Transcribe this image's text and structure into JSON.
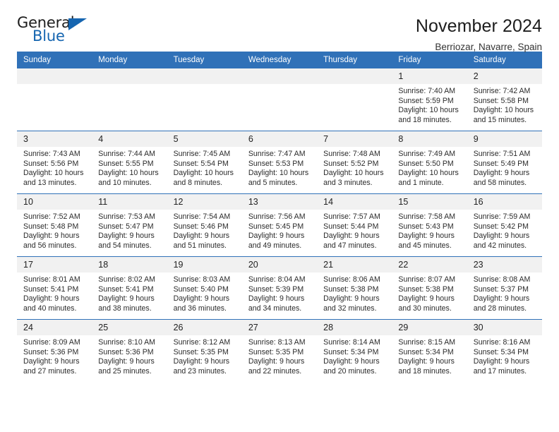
{
  "brand": {
    "word_one": "General",
    "word_two": "Blue",
    "accent_color": "#1565b0",
    "triangle_icon": "triangle-right-icon"
  },
  "header": {
    "title": "November 2024",
    "subtitle": "Berriozar, Navarre, Spain"
  },
  "calendar": {
    "header_bg": "#3071b8",
    "daynum_bg": "#f1f1f1",
    "weekdays": [
      "Sunday",
      "Monday",
      "Tuesday",
      "Wednesday",
      "Thursday",
      "Friday",
      "Saturday"
    ],
    "weeks": [
      [
        {
          "day": "",
          "empty": true
        },
        {
          "day": "",
          "empty": true
        },
        {
          "day": "",
          "empty": true
        },
        {
          "day": "",
          "empty": true
        },
        {
          "day": "",
          "empty": true
        },
        {
          "day": "1",
          "sunrise": "Sunrise: 7:40 AM",
          "sunset": "Sunset: 5:59 PM",
          "daylight_1": "Daylight: 10 hours",
          "daylight_2": "and 18 minutes."
        },
        {
          "day": "2",
          "sunrise": "Sunrise: 7:42 AM",
          "sunset": "Sunset: 5:58 PM",
          "daylight_1": "Daylight: 10 hours",
          "daylight_2": "and 15 minutes."
        }
      ],
      [
        {
          "day": "3",
          "sunrise": "Sunrise: 7:43 AM",
          "sunset": "Sunset: 5:56 PM",
          "daylight_1": "Daylight: 10 hours",
          "daylight_2": "and 13 minutes."
        },
        {
          "day": "4",
          "sunrise": "Sunrise: 7:44 AM",
          "sunset": "Sunset: 5:55 PM",
          "daylight_1": "Daylight: 10 hours",
          "daylight_2": "and 10 minutes."
        },
        {
          "day": "5",
          "sunrise": "Sunrise: 7:45 AM",
          "sunset": "Sunset: 5:54 PM",
          "daylight_1": "Daylight: 10 hours",
          "daylight_2": "and 8 minutes."
        },
        {
          "day": "6",
          "sunrise": "Sunrise: 7:47 AM",
          "sunset": "Sunset: 5:53 PM",
          "daylight_1": "Daylight: 10 hours",
          "daylight_2": "and 5 minutes."
        },
        {
          "day": "7",
          "sunrise": "Sunrise: 7:48 AM",
          "sunset": "Sunset: 5:52 PM",
          "daylight_1": "Daylight: 10 hours",
          "daylight_2": "and 3 minutes."
        },
        {
          "day": "8",
          "sunrise": "Sunrise: 7:49 AM",
          "sunset": "Sunset: 5:50 PM",
          "daylight_1": "Daylight: 10 hours",
          "daylight_2": "and 1 minute."
        },
        {
          "day": "9",
          "sunrise": "Sunrise: 7:51 AM",
          "sunset": "Sunset: 5:49 PM",
          "daylight_1": "Daylight: 9 hours",
          "daylight_2": "and 58 minutes."
        }
      ],
      [
        {
          "day": "10",
          "sunrise": "Sunrise: 7:52 AM",
          "sunset": "Sunset: 5:48 PM",
          "daylight_1": "Daylight: 9 hours",
          "daylight_2": "and 56 minutes."
        },
        {
          "day": "11",
          "sunrise": "Sunrise: 7:53 AM",
          "sunset": "Sunset: 5:47 PM",
          "daylight_1": "Daylight: 9 hours",
          "daylight_2": "and 54 minutes."
        },
        {
          "day": "12",
          "sunrise": "Sunrise: 7:54 AM",
          "sunset": "Sunset: 5:46 PM",
          "daylight_1": "Daylight: 9 hours",
          "daylight_2": "and 51 minutes."
        },
        {
          "day": "13",
          "sunrise": "Sunrise: 7:56 AM",
          "sunset": "Sunset: 5:45 PM",
          "daylight_1": "Daylight: 9 hours",
          "daylight_2": "and 49 minutes."
        },
        {
          "day": "14",
          "sunrise": "Sunrise: 7:57 AM",
          "sunset": "Sunset: 5:44 PM",
          "daylight_1": "Daylight: 9 hours",
          "daylight_2": "and 47 minutes."
        },
        {
          "day": "15",
          "sunrise": "Sunrise: 7:58 AM",
          "sunset": "Sunset: 5:43 PM",
          "daylight_1": "Daylight: 9 hours",
          "daylight_2": "and 45 minutes."
        },
        {
          "day": "16",
          "sunrise": "Sunrise: 7:59 AM",
          "sunset": "Sunset: 5:42 PM",
          "daylight_1": "Daylight: 9 hours",
          "daylight_2": "and 42 minutes."
        }
      ],
      [
        {
          "day": "17",
          "sunrise": "Sunrise: 8:01 AM",
          "sunset": "Sunset: 5:41 PM",
          "daylight_1": "Daylight: 9 hours",
          "daylight_2": "and 40 minutes."
        },
        {
          "day": "18",
          "sunrise": "Sunrise: 8:02 AM",
          "sunset": "Sunset: 5:41 PM",
          "daylight_1": "Daylight: 9 hours",
          "daylight_2": "and 38 minutes."
        },
        {
          "day": "19",
          "sunrise": "Sunrise: 8:03 AM",
          "sunset": "Sunset: 5:40 PM",
          "daylight_1": "Daylight: 9 hours",
          "daylight_2": "and 36 minutes."
        },
        {
          "day": "20",
          "sunrise": "Sunrise: 8:04 AM",
          "sunset": "Sunset: 5:39 PM",
          "daylight_1": "Daylight: 9 hours",
          "daylight_2": "and 34 minutes."
        },
        {
          "day": "21",
          "sunrise": "Sunrise: 8:06 AM",
          "sunset": "Sunset: 5:38 PM",
          "daylight_1": "Daylight: 9 hours",
          "daylight_2": "and 32 minutes."
        },
        {
          "day": "22",
          "sunrise": "Sunrise: 8:07 AM",
          "sunset": "Sunset: 5:38 PM",
          "daylight_1": "Daylight: 9 hours",
          "daylight_2": "and 30 minutes."
        },
        {
          "day": "23",
          "sunrise": "Sunrise: 8:08 AM",
          "sunset": "Sunset: 5:37 PM",
          "daylight_1": "Daylight: 9 hours",
          "daylight_2": "and 28 minutes."
        }
      ],
      [
        {
          "day": "24",
          "sunrise": "Sunrise: 8:09 AM",
          "sunset": "Sunset: 5:36 PM",
          "daylight_1": "Daylight: 9 hours",
          "daylight_2": "and 27 minutes."
        },
        {
          "day": "25",
          "sunrise": "Sunrise: 8:10 AM",
          "sunset": "Sunset: 5:36 PM",
          "daylight_1": "Daylight: 9 hours",
          "daylight_2": "and 25 minutes."
        },
        {
          "day": "26",
          "sunrise": "Sunrise: 8:12 AM",
          "sunset": "Sunset: 5:35 PM",
          "daylight_1": "Daylight: 9 hours",
          "daylight_2": "and 23 minutes."
        },
        {
          "day": "27",
          "sunrise": "Sunrise: 8:13 AM",
          "sunset": "Sunset: 5:35 PM",
          "daylight_1": "Daylight: 9 hours",
          "daylight_2": "and 22 minutes."
        },
        {
          "day": "28",
          "sunrise": "Sunrise: 8:14 AM",
          "sunset": "Sunset: 5:34 PM",
          "daylight_1": "Daylight: 9 hours",
          "daylight_2": "and 20 minutes."
        },
        {
          "day": "29",
          "sunrise": "Sunrise: 8:15 AM",
          "sunset": "Sunset: 5:34 PM",
          "daylight_1": "Daylight: 9 hours",
          "daylight_2": "and 18 minutes."
        },
        {
          "day": "30",
          "sunrise": "Sunrise: 8:16 AM",
          "sunset": "Sunset: 5:34 PM",
          "daylight_1": "Daylight: 9 hours",
          "daylight_2": "and 17 minutes."
        }
      ]
    ]
  }
}
